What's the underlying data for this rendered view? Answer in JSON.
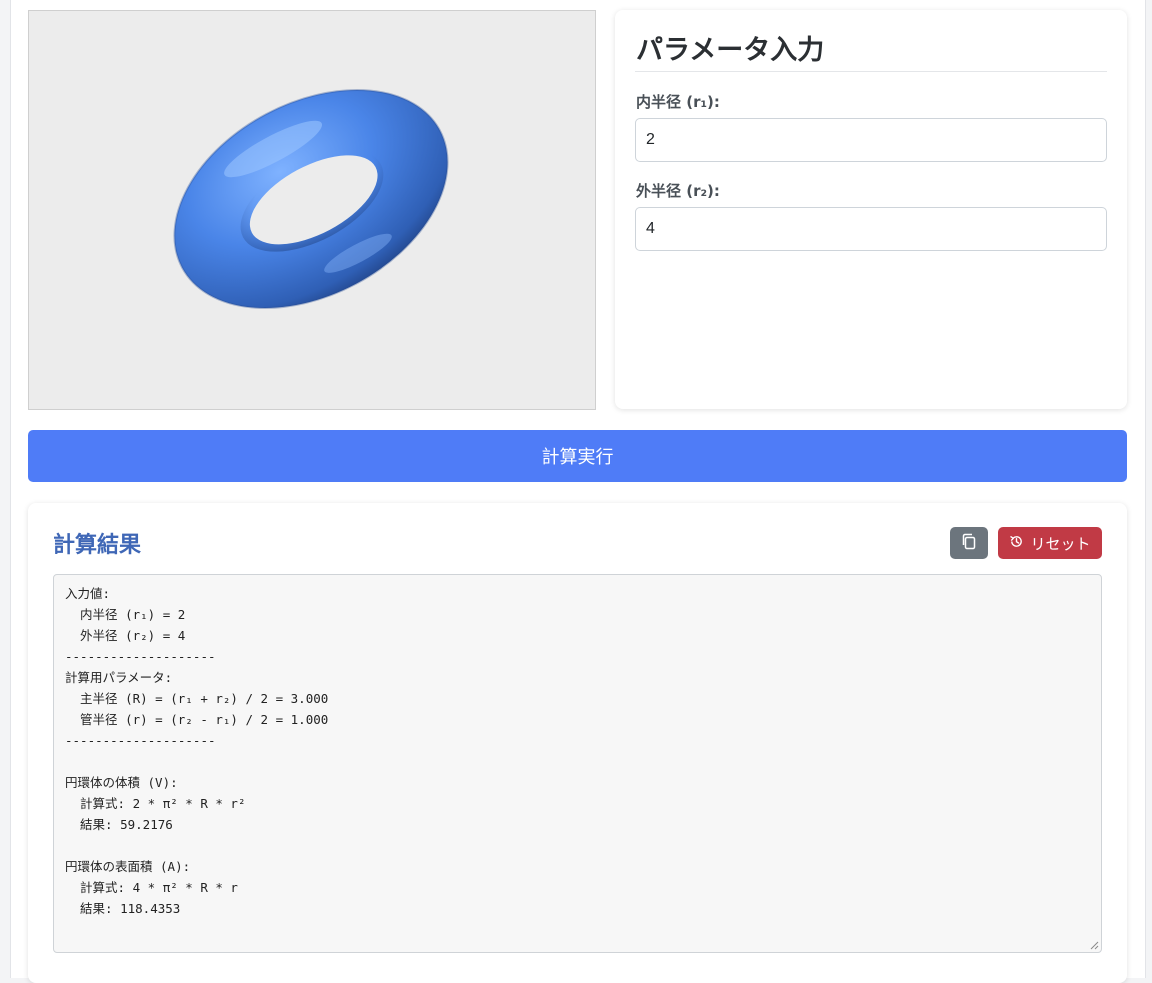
{
  "params": {
    "title": "パラメータ入力",
    "inner_radius_label": "内半径 (r₁):",
    "inner_radius_value": "2",
    "outer_radius_label": "外半径 (r₂):",
    "outer_radius_value": "4"
  },
  "actions": {
    "calculate_label": "計算実行"
  },
  "results": {
    "title": "計算結果",
    "reset_label": "リセット",
    "output_text": "入力値:\n  内半径 (r₁) = 2\n  外半径 (r₂) = 4\n--------------------\n計算用パラメータ:\n  主半径 (R) = (r₁ + r₂) / 2 = 3.000\n  管半径 (r) = (r₂ - r₁) / 2 = 1.000\n--------------------\n\n円環体の体積 (V):\n  計算式: 2 * π² * R * r²\n  結果: 59.2176\n\n円環体の表面積 (A):\n  計算式: 4 * π² * R * r\n  結果: 118.4353"
  },
  "icons": {
    "copy": "copy-icon",
    "reset": "history-icon"
  },
  "colors": {
    "primary": "#4f7cf7",
    "danger": "#c13a45",
    "secondary": "#6c757d",
    "heading_accent": "#3f67b6",
    "torus": "#4a85e8"
  }
}
